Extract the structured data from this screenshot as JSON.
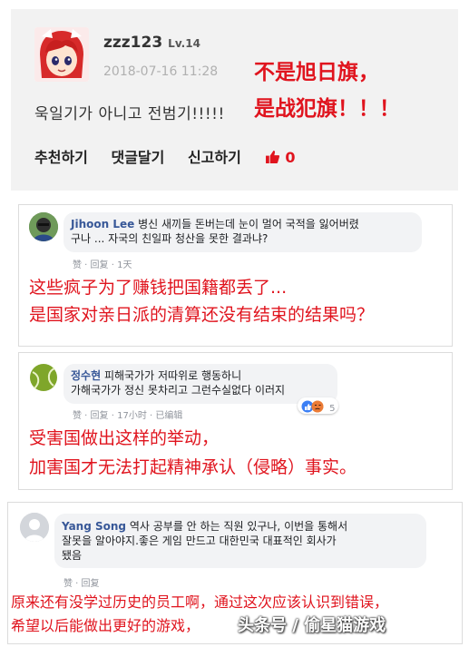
{
  "post": {
    "username": "zzz123",
    "level": "Lv.14",
    "timestamp": "2018-07-16 11:28",
    "body_korean": "욱일기가 아니고 전범기!!!!!",
    "annotation_line1": "不是旭日旗，",
    "annotation_line2": "是战犯旗！！！",
    "actions": [
      "추천하기",
      "댓글달기",
      "신고하기"
    ],
    "like_count": "0"
  },
  "comment1": {
    "name": "Jihoon Lee",
    "text_line1": "병신 새끼들 돈버는데 눈이 멀어 국적을 잃어버렸",
    "text_line2": "구나 ... 자국의 친일파 청산을 못한 결과냐?",
    "like": "赞",
    "reply": "回复",
    "time": "1天",
    "annotation_line1": "这些疯子为了赚钱把国籍都丢了...",
    "annotation_line2": "是国家对亲日派的清算还没有结束的结果吗？"
  },
  "comment2": {
    "name": "정수현",
    "text_line1": "피해국가가 저따위로 행동하니",
    "text_line2": "가해국가가 정신 못차리고 그런수실없다 이러지",
    "reactions_count": "5",
    "like": "赞",
    "reply": "回复",
    "time": "17小时",
    "edited": "已编辑",
    "annotation_line1": "受害国做出这样的举动，",
    "annotation_line2": "加害国才无法打起精神承认（侵略）事实。"
  },
  "comment3": {
    "name": "Yang Song",
    "text_line1": "역사 공부를 안 하는 직원 있구나, 이번을 통해서",
    "text_line2": "잘못을 알아야지.좋은 게임 만드고 대한민국 대표적인 회사가",
    "text_line3": "됐음",
    "like": "赞",
    "reply": "回复",
    "annotation_line1": "原来还有没学过历史的员工啊，通过这次应该认识到错误，",
    "annotation_line2": "希望以后能做出更好的游戏，",
    "watermark": "头条号 / 偷星猫游戏"
  },
  "colors": {
    "accent_red": "#e0141e",
    "fb_blue": "#385898"
  },
  "icons": {
    "thumb": "thumbs-up-icon",
    "reactions": "like-and-angry-reactions-icon"
  }
}
